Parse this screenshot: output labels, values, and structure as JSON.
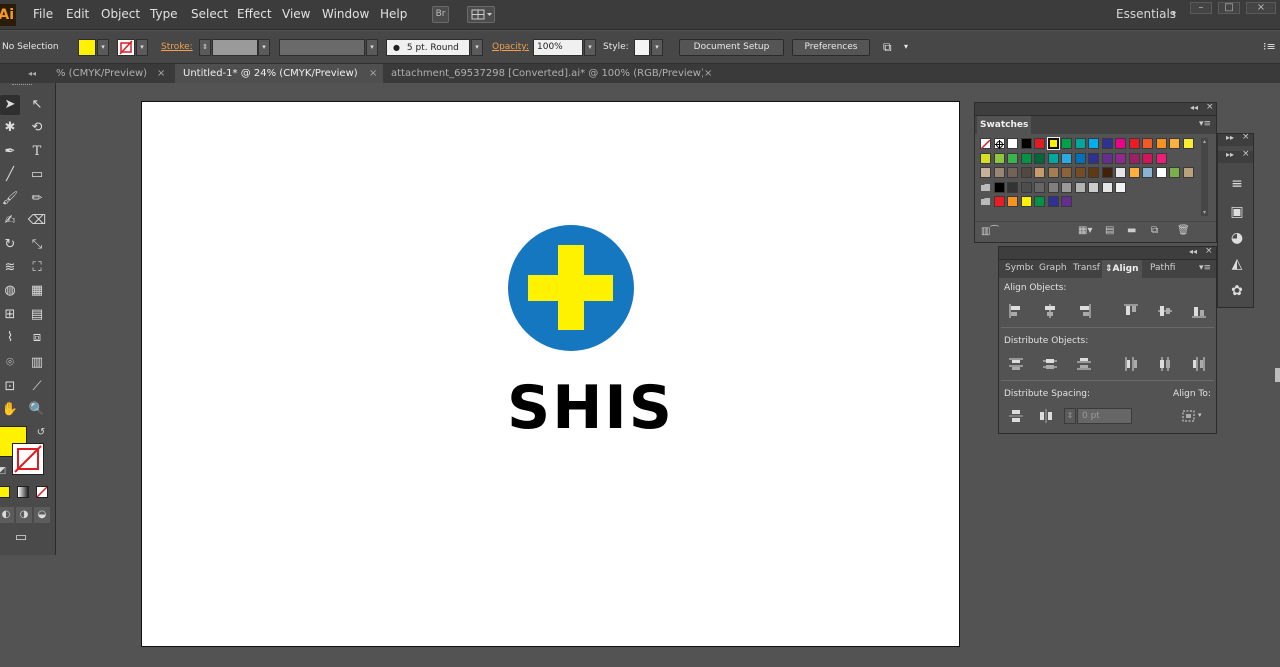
{
  "app": {
    "logo": "Ai",
    "menu": [
      "File",
      "Edit",
      "Object",
      "Type",
      "Select",
      "Effect",
      "View",
      "Window",
      "Help"
    ],
    "bridge_button": "Br",
    "workspace": "Essentials"
  },
  "controlbar": {
    "selection_label": "No Selection",
    "stroke_label": "Stroke:",
    "brush_value": "5 pt. Round",
    "opacity_label": "Opacity:",
    "opacity_value": "100%",
    "style_label": "Style:",
    "document_setup": "Document Setup",
    "preferences": "Preferences",
    "colors": {
      "fill": "#FFF200",
      "accent_link": "#F0A050"
    }
  },
  "tabs": [
    {
      "label": "% (CMYK/Preview)",
      "active": false
    },
    {
      "label": "Untitled-1* @ 24% (CMYK/Preview)",
      "active": true
    },
    {
      "label": "attachment_69537298 [Converted].ai* @ 100% (RGB/Preview)",
      "active": false
    }
  ],
  "tab_close_glyph": "×",
  "artboard": {
    "logo_text": "SHIS",
    "colors": {
      "circle": "#1477BF",
      "cross": "#FFF200",
      "text": "#000000"
    }
  },
  "swatches_panel": {
    "title": "Swatches",
    "rows": [
      [
        "none",
        "reg",
        "#FFFFFF",
        "#000000",
        "#E11B22",
        "#FFF200",
        "#00A14B",
        "#00A79D",
        "#00AEEF",
        "#2E3192",
        "#EC008C",
        "#ED1C24",
        "#F15A24",
        "#F7931E",
        "#FBB040",
        "#F9ED32"
      ],
      [
        "#D7DF23",
        "#8DC63F",
        "#39B54A",
        "#009444",
        "#006838",
        "#00A99D",
        "#29ABE2",
        "#0071BC",
        "#2E3192",
        "#662D91",
        "#92278F",
        "#9E1F63",
        "#D4145A",
        "#ED1E79"
      ],
      [
        "#C7B299",
        "#998675",
        "#736357",
        "#534741",
        "#C69C6D",
        "#A67C52",
        "#8C6239",
        "#754C24",
        "#603813",
        "#42210B",
        "#E6E6E6",
        "#FBB040",
        "#8AB4D4",
        "#FFFFFF",
        "#7AAF4A",
        "#B7A27A"
      ],
      [
        "folder",
        "#000000",
        "#333333",
        "#4D4D4D",
        "#666666",
        "#808080",
        "#999999",
        "#B3B3B3",
        "#CCCCCC",
        "#E6E6E6",
        "#F2F2F2"
      ],
      [
        "folder",
        "#ED1C24",
        "#F7931E",
        "#FFF200",
        "#009245",
        "#2E3192",
        "#662D91"
      ]
    ]
  },
  "align_panel": {
    "tabs": [
      "Symbo",
      "Graph",
      "Transf",
      "Align",
      "Pathfi"
    ],
    "align_objects": "Align Objects:",
    "distribute_objects": "Distribute Objects:",
    "distribute_spacing": "Distribute Spacing:",
    "align_to": "Align To:",
    "spacing_value": "0 pt"
  }
}
